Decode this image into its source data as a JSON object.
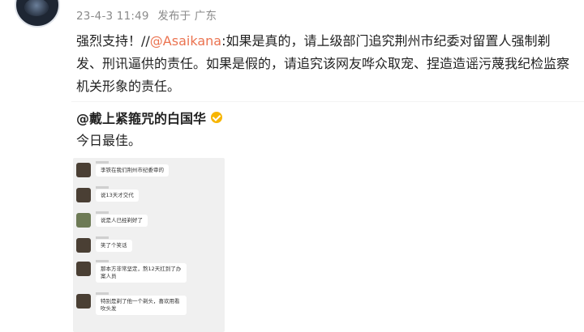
{
  "post": {
    "timestamp": "23-4-3 11:49",
    "source": "发布于 广东",
    "text_before": "强烈支持！//",
    "mention": "@Asaikana",
    "text_after": ":如果是真的，请上级部门追究荆州市纪委对留置人强制剃发、刑讯逼供的责任。如果是假的，请追究该网友哗众取宠、捏造造谣污蔑我纪检监察机关形象的责任。"
  },
  "quoted": {
    "author": "@戴上紧箍咒的白国华",
    "text": "今日最佳。"
  },
  "chat": {
    "messages": [
      {
        "text": "李铁在我们荆州市纪委审的"
      },
      {
        "text": "说13天才交代"
      },
      {
        "text": "说是人已经剃好了"
      },
      {
        "text": "笑了个笑话"
      },
      {
        "text": "那本方非常坚定，熬12天扛到了办案人员"
      },
      {
        "text": "特别是剃了他一个剃头，喜欢用看吹头发"
      }
    ]
  }
}
